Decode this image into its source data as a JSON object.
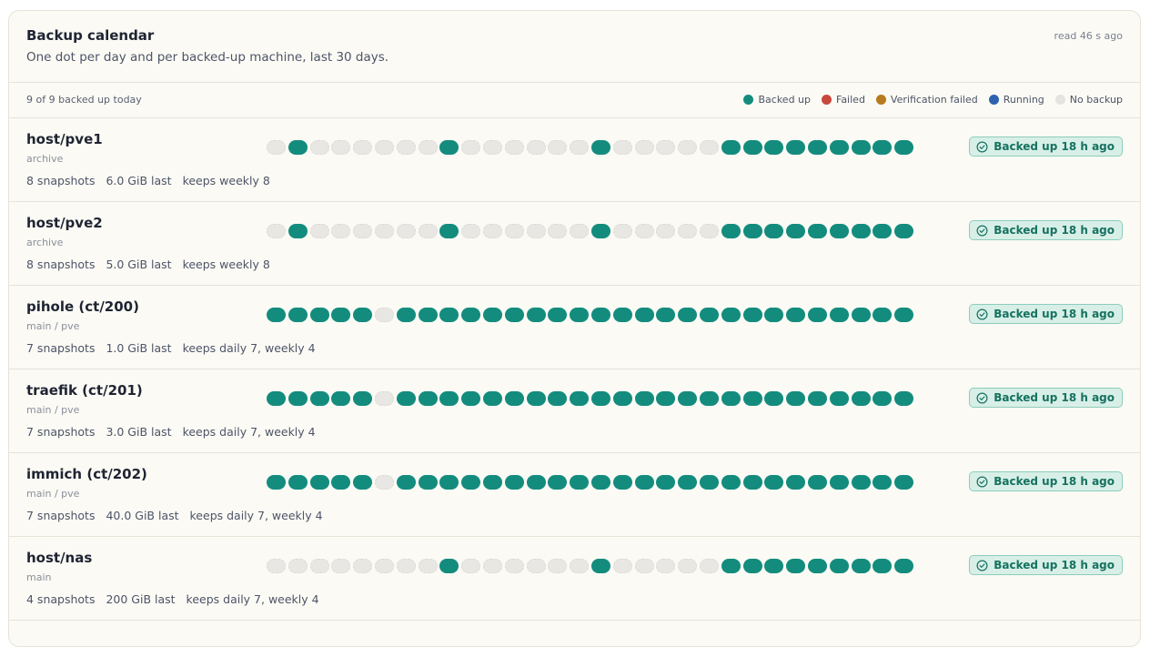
{
  "header": {
    "title": "Backup calendar",
    "subtitle": "One dot per day and per backed-up machine, last 30 days.",
    "read_ago": "read 46 s ago"
  },
  "summary": {
    "text": "9 of 9 backed up today"
  },
  "legend": [
    {
      "label": "Backed up",
      "color": "#138c7e"
    },
    {
      "label": "Failed",
      "color": "#c8483b"
    },
    {
      "label": "Verification failed",
      "color": "#b87a1e"
    },
    {
      "label": "Running",
      "color": "#2f63b0"
    },
    {
      "label": "No backup",
      "color": "#e5e4e0"
    }
  ],
  "colors": {
    "ok": "#138c7e",
    "none": "#e8e7e3"
  },
  "rows": [
    {
      "name": "host/pve1",
      "namespace": "archive",
      "snapshots": "8 snapshots",
      "size": "6.0 GiB last",
      "retention": "keeps weekly 8",
      "status": "Backed up 18 h ago",
      "days": [
        0,
        1,
        0,
        0,
        0,
        0,
        0,
        0,
        1,
        0,
        0,
        0,
        0,
        0,
        0,
        1,
        0,
        0,
        0,
        0,
        0,
        1,
        1,
        1,
        1,
        1,
        1,
        1,
        1,
        1
      ]
    },
    {
      "name": "host/pve2",
      "namespace": "archive",
      "snapshots": "8 snapshots",
      "size": "5.0 GiB last",
      "retention": "keeps weekly 8",
      "status": "Backed up 18 h ago",
      "days": [
        0,
        1,
        0,
        0,
        0,
        0,
        0,
        0,
        1,
        0,
        0,
        0,
        0,
        0,
        0,
        1,
        0,
        0,
        0,
        0,
        0,
        1,
        1,
        1,
        1,
        1,
        1,
        1,
        1,
        1
      ]
    },
    {
      "name": "pihole (ct/200)",
      "namespace": "main / pve",
      "snapshots": "7 snapshots",
      "size": "1.0 GiB last",
      "retention": "keeps daily 7, weekly 4",
      "status": "Backed up 18 h ago",
      "days": [
        1,
        1,
        1,
        1,
        1,
        0,
        1,
        1,
        1,
        1,
        1,
        1,
        1,
        1,
        1,
        1,
        1,
        1,
        1,
        1,
        1,
        1,
        1,
        1,
        1,
        1,
        1,
        1,
        1,
        1
      ]
    },
    {
      "name": "traefik (ct/201)",
      "namespace": "main / pve",
      "snapshots": "7 snapshots",
      "size": "3.0 GiB last",
      "retention": "keeps daily 7, weekly 4",
      "status": "Backed up 18 h ago",
      "days": [
        1,
        1,
        1,
        1,
        1,
        0,
        1,
        1,
        1,
        1,
        1,
        1,
        1,
        1,
        1,
        1,
        1,
        1,
        1,
        1,
        1,
        1,
        1,
        1,
        1,
        1,
        1,
        1,
        1,
        1
      ]
    },
    {
      "name": "immich (ct/202)",
      "namespace": "main / pve",
      "snapshots": "7 snapshots",
      "size": "40.0 GiB last",
      "retention": "keeps daily 7, weekly 4",
      "status": "Backed up 18 h ago",
      "days": [
        1,
        1,
        1,
        1,
        1,
        0,
        1,
        1,
        1,
        1,
        1,
        1,
        1,
        1,
        1,
        1,
        1,
        1,
        1,
        1,
        1,
        1,
        1,
        1,
        1,
        1,
        1,
        1,
        1,
        1
      ]
    },
    {
      "name": "host/nas",
      "namespace": "main",
      "snapshots": "4 snapshots",
      "size": "200 GiB last",
      "retention": "keeps daily 7, weekly 4",
      "status": "Backed up 18 h ago",
      "days": [
        0,
        0,
        0,
        0,
        0,
        0,
        0,
        0,
        1,
        0,
        0,
        0,
        0,
        0,
        0,
        1,
        0,
        0,
        0,
        0,
        0,
        1,
        1,
        1,
        1,
        1,
        1,
        1,
        1,
        1
      ]
    }
  ]
}
